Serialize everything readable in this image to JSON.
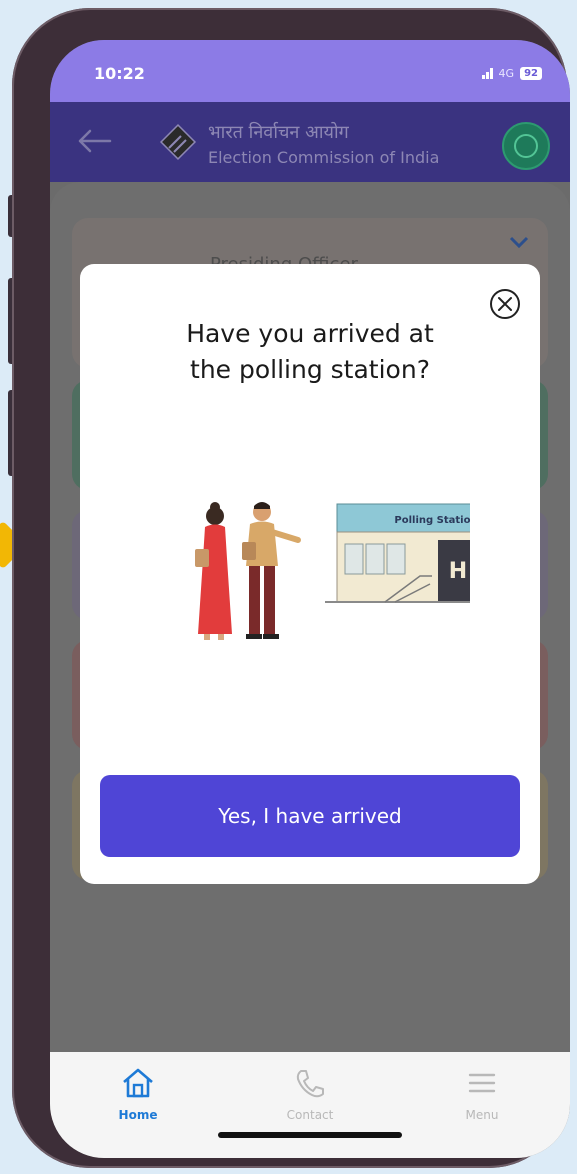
{
  "status_bar": {
    "time": "10:22",
    "network": "4G",
    "battery": "92"
  },
  "header": {
    "title_hindi": "भारत निर्वाचन आयोग",
    "title_english": "Election Commission of India"
  },
  "background_card": {
    "title": "Presiding Officer"
  },
  "modal": {
    "title_line1": "Have you arrived at",
    "title_line2": "the polling station?",
    "illustration_sign": "Polling Station",
    "illustration_door": "H",
    "confirm_label": "Yes, I have arrived"
  },
  "bottom_nav": {
    "items": [
      {
        "label": "Home",
        "icon": "home-icon",
        "active": true
      },
      {
        "label": "Contact",
        "icon": "phone-icon",
        "active": false
      },
      {
        "label": "Menu",
        "icon": "menu-icon",
        "active": false
      }
    ]
  },
  "colors": {
    "brand_purple": "#4f45d6",
    "header_bg": "#3a3380",
    "status_bar": "#8c7be6",
    "home_active": "#1e7ad6",
    "nav_inactive": "#b8b8b8"
  }
}
